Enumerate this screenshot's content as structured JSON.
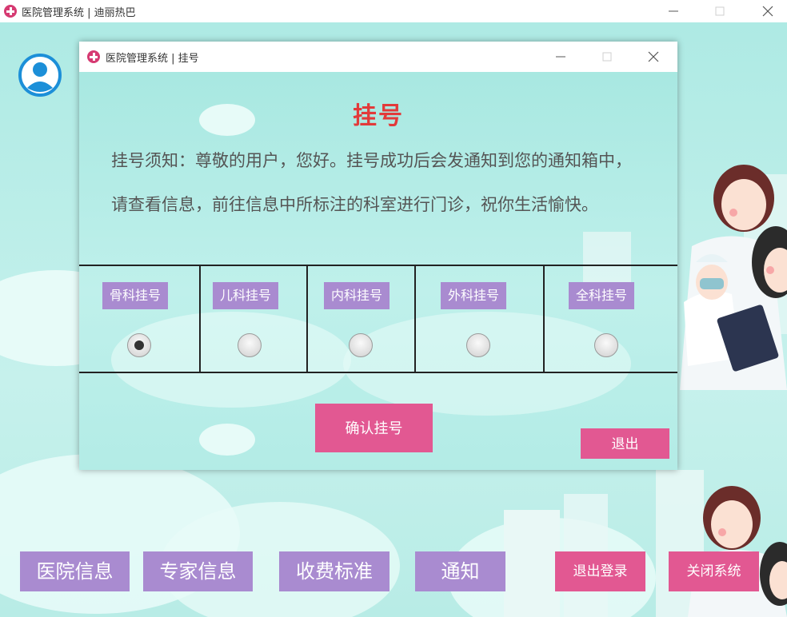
{
  "main_window": {
    "title": "医院管理系统 | 迪丽热巴"
  },
  "dialog": {
    "title": "医院管理系统 | 挂号",
    "heading": "挂号",
    "notice_lines": [
      "挂号须知：尊敬的用户，您好。挂号成功后会发通知到您的通知箱中，",
      "请查看信息，前往信息中所标注的科室进行门诊，祝你生活愉快。"
    ],
    "departments": [
      {
        "label": "骨科挂号",
        "selected": true
      },
      {
        "label": "儿科挂号",
        "selected": false
      },
      {
        "label": "内科挂号",
        "selected": false
      },
      {
        "label": "外科挂号",
        "selected": false
      },
      {
        "label": "全科挂号",
        "selected": false
      }
    ],
    "confirm_label": "确认挂号",
    "exit_label": "退出"
  },
  "nav": {
    "items": [
      "医院信息",
      "专家信息",
      "收费标准",
      "通知"
    ],
    "logout_label": "退出登录",
    "close_label": "关闭系统"
  },
  "icons": {
    "app_logo": "hospital-cross-icon",
    "avatar": "user-avatar-icon"
  },
  "colors": {
    "accent_pink": "#e25892",
    "accent_purple": "#a98bd0",
    "heading_red": "#e23a3a",
    "background_teal": "#b6ece6"
  }
}
